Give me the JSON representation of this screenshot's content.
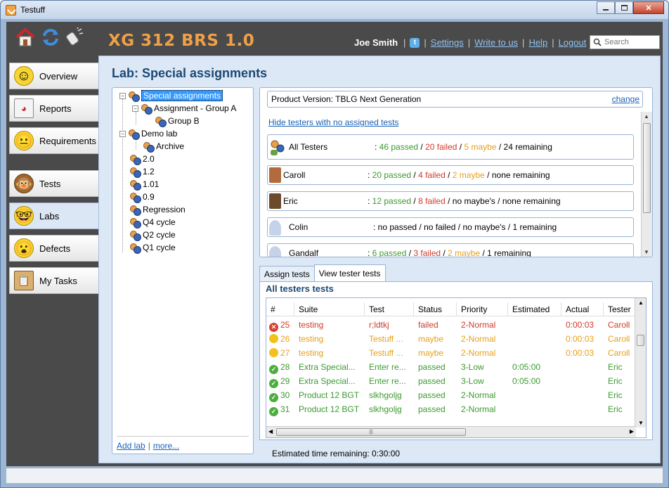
{
  "window": {
    "title": "Testuff"
  },
  "header": {
    "app_title": "XG 312 BRS 1.0",
    "user_name": "Joe Smith",
    "links": [
      "Settings",
      "Write to us",
      "Help",
      "Logout"
    ],
    "search_placeholder": "Search"
  },
  "nav": {
    "items": [
      {
        "label": "Overview",
        "icon": "smiley-halo-icon"
      },
      {
        "label": "Reports",
        "icon": "report-chart-icon"
      },
      {
        "label": "Requirements",
        "icon": "smiley-neutral-icon"
      },
      {
        "label": "Tests",
        "icon": "monkey-icon"
      },
      {
        "label": "Labs",
        "icon": "smiley-glasses-icon"
      },
      {
        "label": "Defects",
        "icon": "smiley-shocked-icon"
      },
      {
        "label": "My Tasks",
        "icon": "clipboard-icon"
      }
    ]
  },
  "page": {
    "title": "Lab: Special assignments"
  },
  "tree": {
    "items": [
      "Special assignments",
      "Assignment - Group A",
      "Group B",
      "Demo lab",
      "Archive",
      "2.0",
      "1.2",
      "1.01",
      "0.9",
      "Regression",
      "Q4 cycle",
      "Q2 cycle",
      "Q1 cycle"
    ],
    "footer": {
      "add_lab": "Add lab",
      "more": "more..."
    }
  },
  "testers_panel": {
    "product_version": "Product Version: TBLG Next Generation",
    "change_link": "change",
    "hide_link": "Hide testers with no assigned tests",
    "rows": [
      {
        "name": "All Testers",
        "passed": "46 passed",
        "failed": "20 failed",
        "maybe": "5 maybe",
        "remaining": "24 remaining"
      },
      {
        "name": "Caroll",
        "passed": "20 passed",
        "failed": "4 failed",
        "maybe": "2 maybe",
        "remaining": "none remaining"
      },
      {
        "name": "Eric",
        "passed": "12 passed",
        "failed": "8 failed",
        "maybe": "no maybe's",
        "remaining": "none remaining"
      },
      {
        "name": "Colin",
        "passed": "no passed",
        "failed": "no failed",
        "maybe": "no maybe's",
        "remaining": "1 remaining"
      },
      {
        "name": "Gandalf",
        "passed": "6 passed",
        "failed": "3 failed",
        "maybe": "2 maybe",
        "remaining": "1 remaining"
      }
    ]
  },
  "tabs": [
    "Assign tests",
    "View tester tests"
  ],
  "tests_panel": {
    "title": "All testers tests",
    "columns": [
      "#",
      "Suite",
      "Test",
      "Status",
      "Priority",
      "Estimated",
      "Actual",
      "Tester"
    ],
    "rows": [
      {
        "num": "25",
        "suite": "testing",
        "test": "r;ldtkj",
        "status": "failed",
        "priority": "2-Normal",
        "estimated": "",
        "actual": "0:00:03",
        "tester": "Caroll",
        "kind": "fail"
      },
      {
        "num": "26",
        "suite": "testing",
        "test": "Testuff ...",
        "status": "maybe",
        "priority": "2-Normal",
        "estimated": "",
        "actual": "0:00:03",
        "tester": "Caroll",
        "kind": "maybe"
      },
      {
        "num": "27",
        "suite": "testing",
        "test": "Testuff ...",
        "status": "maybe",
        "priority": "2-Normal",
        "estimated": "",
        "actual": "0:00:03",
        "tester": "Caroll",
        "kind": "maybe"
      },
      {
        "num": "28",
        "suite": "Extra Special...",
        "test": "Enter re...",
        "status": "passed",
        "priority": "3-Low",
        "estimated": "0:05:00",
        "actual": "",
        "tester": "Eric",
        "kind": "pass"
      },
      {
        "num": "29",
        "suite": "Extra Special...",
        "test": "Enter re...",
        "status": "passed",
        "priority": "3-Low",
        "estimated": "0:05:00",
        "actual": "",
        "tester": "Eric",
        "kind": "pass"
      },
      {
        "num": "30",
        "suite": "Product 12 BGT",
        "test": "slkhgoljg",
        "status": "passed",
        "priority": "2-Normal",
        "estimated": "",
        "actual": "",
        "tester": "Eric",
        "kind": "pass"
      },
      {
        "num": "31",
        "suite": "Product 12 BGT",
        "test": "slkhgoljg",
        "status": "passed",
        "priority": "2-Normal",
        "estimated": "",
        "actual": "",
        "tester": "Eric",
        "kind": "pass"
      }
    ],
    "estimated_remaining": "Estimated time remaining: 0:30:00"
  },
  "colors": {
    "passed": "#3a9b2e",
    "failed": "#d13a2a",
    "maybe": "#e6a01c",
    "accent_title": "#f0a047"
  }
}
